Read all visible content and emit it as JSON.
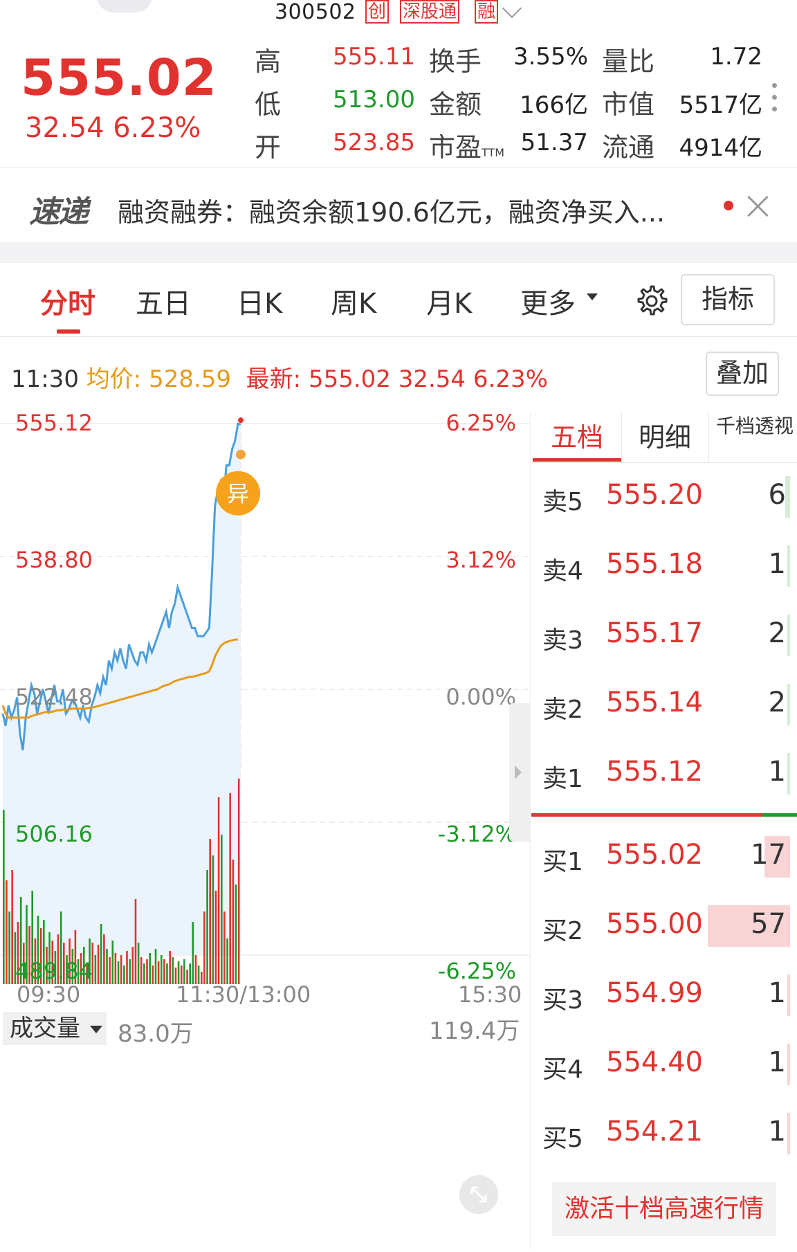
{
  "header": {
    "code": "300502",
    "tags": [
      "创",
      "深股通",
      "融"
    ],
    "price": "555.02",
    "change": "32.54",
    "change_pct": "6.23%",
    "quote": [
      {
        "label": "高",
        "value": "555.11",
        "color": "#e0332f"
      },
      {
        "label": "低",
        "value": "513.00",
        "color": "#1e9a2a"
      },
      {
        "label": "开",
        "value": "523.85",
        "color": "#e0332f"
      },
      {
        "label": "换手",
        "value": "3.55%"
      },
      {
        "label": "金额",
        "value": "166亿"
      },
      {
        "label": "市盈",
        "label_sub": "TTM",
        "value": "51.37"
      },
      {
        "label": "量比",
        "value": "1.72"
      },
      {
        "label": "市值",
        "value": "5517亿"
      },
      {
        "label": "流通",
        "value": "4914亿"
      }
    ]
  },
  "news": {
    "logo": "速递",
    "text": "融资融券：融资余额190.6亿元，融资净买入..."
  },
  "tabs": [
    "分时",
    "五日",
    "日K",
    "周K",
    "月K",
    "更多"
  ],
  "indicator_label": "指标",
  "info": {
    "time": "11:30",
    "avg_label": "均价:",
    "avg_value": "528.59",
    "latest_label": "最新:",
    "latest_value": "555.02 32.54 6.23%"
  },
  "overlay_label": "叠加",
  "chart_data": {
    "type": "line",
    "y_axis_left": [
      "555.12",
      "538.80",
      "522.48",
      "506.16",
      "489.84"
    ],
    "y_axis_right": [
      "6.25%",
      "3.12%",
      "0.00%",
      "-3.12%",
      "-6.25%"
    ],
    "ylim": [
      489.84,
      555.12
    ],
    "x_ticks": [
      "09:30",
      "11:30/13:00",
      "15:30"
    ],
    "series": [
      {
        "name": "",
        "color": "#4a9fdc",
        "values": [
          519.5,
          518,
          520.5,
          519,
          520,
          521.5,
          517,
          515,
          519,
          521,
          523,
          522,
          519.5,
          521,
          522.5,
          521,
          519.5,
          521.5,
          523,
          521,
          521,
          522.5,
          519.5,
          520,
          521,
          521,
          520,
          519,
          520.5,
          519,
          518.5,
          520.5,
          521.5,
          523,
          522,
          524,
          523,
          526,
          525,
          527,
          526,
          527.5,
          526,
          525,
          528,
          527,
          526,
          525.5,
          527,
          527,
          526,
          528,
          527,
          528,
          529,
          530,
          531,
          532,
          530,
          532,
          533,
          535,
          534,
          533,
          532,
          531,
          530,
          530,
          529,
          529,
          529,
          529.5,
          530,
          537,
          545,
          547,
          548,
          546,
          550,
          550,
          552,
          553,
          555.1,
          555.02
        ]
      },
      {
        "name": "",
        "color": "#e69a1b",
        "values": [
          520.5,
          519.5,
          519,
          519,
          519,
          519,
          519,
          519,
          519,
          519,
          519.2,
          519.3,
          519.4,
          519.5,
          519.6,
          519.7,
          519.7,
          519.7,
          519.8,
          519.9,
          519.9,
          520,
          520,
          520,
          520.1,
          520.1,
          520.1,
          520.1,
          520.1,
          520.1,
          520.2,
          520.2,
          520.3,
          520.4,
          520.5,
          520.6,
          520.7,
          520.8,
          520.9,
          521,
          521.1,
          521.2,
          521.3,
          521.4,
          521.5,
          521.6,
          521.7,
          521.8,
          521.9,
          522,
          522.1,
          522.2,
          522.3,
          522.4,
          522.5,
          522.7,
          522.9,
          523,
          523.1,
          523.3,
          523.5,
          523.6,
          523.7,
          523.8,
          523.9,
          524,
          524,
          524.1,
          524.2,
          524.3,
          524.4,
          524.5,
          524.7,
          525.5,
          526.5,
          527.2,
          527.8,
          528.1,
          528.3,
          528.4,
          528.5,
          528.6,
          528.59
        ]
      }
    ],
    "last_point": 555.02,
    "volume": {
      "label": "成交量",
      "value": "83.0万",
      "max": "119.4万",
      "bars": [
        {
          "v": 0.84,
          "c": "g"
        },
        {
          "v": 0.5,
          "c": "r"
        },
        {
          "v": 0.35,
          "c": "g"
        },
        {
          "v": 0.55,
          "c": "r"
        },
        {
          "v": 0.25,
          "c": "g"
        },
        {
          "v": 0.3,
          "c": "r"
        },
        {
          "v": 0.42,
          "c": "g"
        },
        {
          "v": 0.2,
          "c": "r"
        },
        {
          "v": 0.38,
          "c": "g"
        },
        {
          "v": 0.28,
          "c": "r"
        },
        {
          "v": 0.45,
          "c": "g"
        },
        {
          "v": 0.22,
          "c": "r"
        },
        {
          "v": 0.33,
          "c": "g"
        },
        {
          "v": 0.27,
          "c": "r"
        },
        {
          "v": 0.31,
          "c": "g"
        },
        {
          "v": 0.18,
          "c": "r"
        },
        {
          "v": 0.25,
          "c": "g"
        },
        {
          "v": 0.21,
          "c": "r"
        },
        {
          "v": 0.16,
          "c": "g"
        },
        {
          "v": 0.24,
          "c": "r"
        },
        {
          "v": 0.35,
          "c": "g"
        },
        {
          "v": 0.2,
          "c": "r"
        },
        {
          "v": 0.14,
          "c": "g"
        },
        {
          "v": 0.22,
          "c": "r"
        },
        {
          "v": 0.17,
          "c": "g"
        },
        {
          "v": 0.26,
          "c": "r"
        },
        {
          "v": 0.12,
          "c": "g"
        },
        {
          "v": 0.15,
          "c": "r"
        },
        {
          "v": 0.18,
          "c": "g"
        },
        {
          "v": 0.1,
          "c": "r"
        },
        {
          "v": 0.22,
          "c": "g"
        },
        {
          "v": 0.2,
          "c": "r"
        },
        {
          "v": 0.14,
          "c": "g"
        },
        {
          "v": 0.19,
          "c": "r"
        },
        {
          "v": 0.29,
          "c": "g"
        },
        {
          "v": 0.24,
          "c": "r"
        },
        {
          "v": 0.17,
          "c": "g"
        },
        {
          "v": 0.13,
          "c": "r"
        },
        {
          "v": 0.21,
          "c": "g"
        },
        {
          "v": 0.15,
          "c": "r"
        },
        {
          "v": 0.11,
          "c": "g"
        },
        {
          "v": 0.14,
          "c": "r"
        },
        {
          "v": 0.09,
          "c": "g"
        },
        {
          "v": 0.16,
          "c": "r"
        },
        {
          "v": 0.12,
          "c": "g"
        },
        {
          "v": 0.18,
          "c": "r"
        },
        {
          "v": 0.41,
          "c": "r"
        },
        {
          "v": 0.2,
          "c": "g"
        },
        {
          "v": 0.13,
          "c": "r"
        },
        {
          "v": 0.1,
          "c": "g"
        },
        {
          "v": 0.12,
          "c": "r"
        },
        {
          "v": 0.15,
          "c": "g"
        },
        {
          "v": 0.09,
          "c": "r"
        },
        {
          "v": 0.17,
          "c": "g"
        },
        {
          "v": 0.11,
          "c": "r"
        },
        {
          "v": 0.14,
          "c": "g"
        },
        {
          "v": 0.12,
          "c": "r"
        },
        {
          "v": 0.1,
          "c": "g"
        },
        {
          "v": 0.16,
          "c": "r"
        },
        {
          "v": 0.13,
          "c": "g"
        },
        {
          "v": 0.08,
          "c": "r"
        },
        {
          "v": 0.11,
          "c": "g"
        },
        {
          "v": 0.09,
          "c": "r"
        },
        {
          "v": 0.12,
          "c": "g"
        },
        {
          "v": 0.07,
          "c": "r"
        },
        {
          "v": 0.1,
          "c": "g"
        },
        {
          "v": 0.3,
          "c": "g"
        },
        {
          "v": 0.14,
          "c": "r"
        },
        {
          "v": 0.09,
          "c": "g"
        },
        {
          "v": 0.06,
          "c": "r"
        },
        {
          "v": 0.35,
          "c": "r"
        },
        {
          "v": 0.55,
          "c": "g"
        },
        {
          "v": 0.7,
          "c": "r"
        },
        {
          "v": 0.62,
          "c": "g"
        },
        {
          "v": 0.45,
          "c": "r"
        },
        {
          "v": 0.9,
          "c": "r"
        },
        {
          "v": 0.72,
          "c": "g"
        },
        {
          "v": 0.35,
          "c": "r"
        },
        {
          "v": 0.22,
          "c": "g"
        },
        {
          "v": 0.92,
          "c": "r"
        },
        {
          "v": 0.6,
          "c": "r"
        },
        {
          "v": 0.48,
          "c": "g"
        },
        {
          "v": 0.99,
          "c": "r"
        }
      ]
    }
  },
  "alert_badge": "异",
  "order_book": {
    "tabs": [
      "五档",
      "明细",
      "千档透视"
    ],
    "sells": [
      {
        "name": "卖5",
        "price": "555.20",
        "qty": "6",
        "bar": 0.02
      },
      {
        "name": "卖4",
        "price": "555.18",
        "qty": "1",
        "bar": 0.01
      },
      {
        "name": "卖3",
        "price": "555.17",
        "qty": "2",
        "bar": 0.01
      },
      {
        "name": "卖2",
        "price": "555.14",
        "qty": "2",
        "bar": 0.01
      },
      {
        "name": "卖1",
        "price": "555.12",
        "qty": "1",
        "bar": 0.01
      }
    ],
    "buys": [
      {
        "name": "买1",
        "price": "555.02",
        "qty": "17",
        "bar": 0.1
      },
      {
        "name": "买2",
        "price": "555.00",
        "qty": "57",
        "bar": 0.32
      },
      {
        "name": "买3",
        "price": "554.99",
        "qty": "1",
        "bar": 0.01
      },
      {
        "name": "买4",
        "price": "554.40",
        "qty": "1",
        "bar": 0.01
      },
      {
        "name": "买5",
        "price": "554.21",
        "qty": "1",
        "bar": 0.01
      }
    ],
    "activate_label": "激活十档高速行情"
  }
}
